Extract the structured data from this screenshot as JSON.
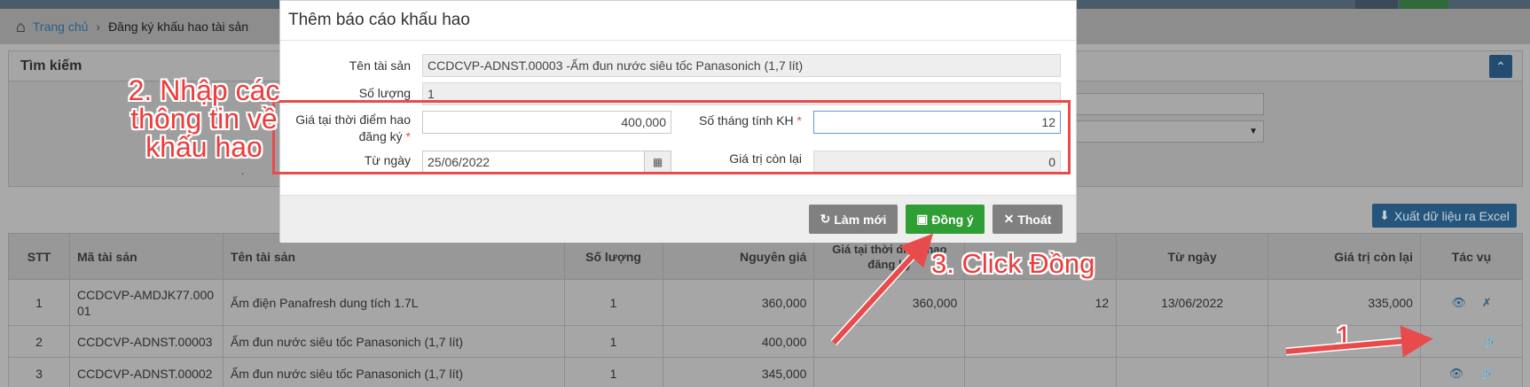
{
  "breadcrumb": {
    "home": "Trang chủ",
    "current": "Đăng ký khấu hao tài sản"
  },
  "search": {
    "title": "Tìm kiếm",
    "collapse_icon": "double-chevron-up-icon",
    "frag1": "N",
    "frag2": "."
  },
  "export_button": "Xuất dữ liệu ra Excel",
  "table": {
    "headers": {
      "stt": "STT",
      "code": "Mã tài sản",
      "name": "Tên tài sản",
      "qty": "Số lượng",
      "orig": "Nguyên giá",
      "reg": "Giá tại thời điểm hao đăng ký",
      "months": "",
      "from": "Từ ngày",
      "rem": "Giá trị còn lại",
      "act": "Tác vụ"
    },
    "rows": [
      {
        "stt": "1",
        "code": "CCDCVP-AMDJK77.00001",
        "name": "Ấm điện Panafresh dung tích 1.7L",
        "qty": "1",
        "orig": "360,000",
        "reg": "360,000",
        "months": "12",
        "from": "13/06/2022",
        "rem": "335,000"
      },
      {
        "stt": "2",
        "code": "CCDCVP-ADNST.00003",
        "name": "Ấm đun nước siêu tốc Panasonich (1,7 lít)",
        "qty": "1",
        "orig": "400,000",
        "reg": "",
        "months": "",
        "from": "",
        "rem": ""
      },
      {
        "stt": "3",
        "code": "CCDCVP-ADNST.00002",
        "name": "Ấm đun nước siêu tốc Panasonich (1,7 lít)",
        "qty": "1",
        "orig": "345,000",
        "reg": "",
        "months": "",
        "from": "",
        "rem": ""
      }
    ]
  },
  "modal": {
    "title": "Thêm báo cáo khấu hao",
    "labels": {
      "asset_name": "Tên tài sản",
      "quantity": "Số lượng",
      "reg_price_line1": "Giá tại thời điểm hao",
      "reg_price_line2": "đăng ký",
      "months": "Số tháng tính KH",
      "from_date": "Từ ngày",
      "remaining": "Giá trị còn lại",
      "required_mark": "*"
    },
    "values": {
      "asset_name": "CCDCVP-ADNST.00003 -Ấm đun nước siêu tốc Panasonich  (1,7 lít)",
      "quantity": "1",
      "reg_price": "400,000",
      "months": "12",
      "from_date": "25/06/2022",
      "remaining": "0"
    },
    "buttons": {
      "refresh": "Làm mới",
      "ok": "Đồng ý",
      "exit": "Thoát"
    }
  },
  "annotations": {
    "step1": "1",
    "step2": "2. Nhập các thông tin về khấu hao",
    "step3": "3. Click Đồng",
    "color": "#e84b4b"
  }
}
